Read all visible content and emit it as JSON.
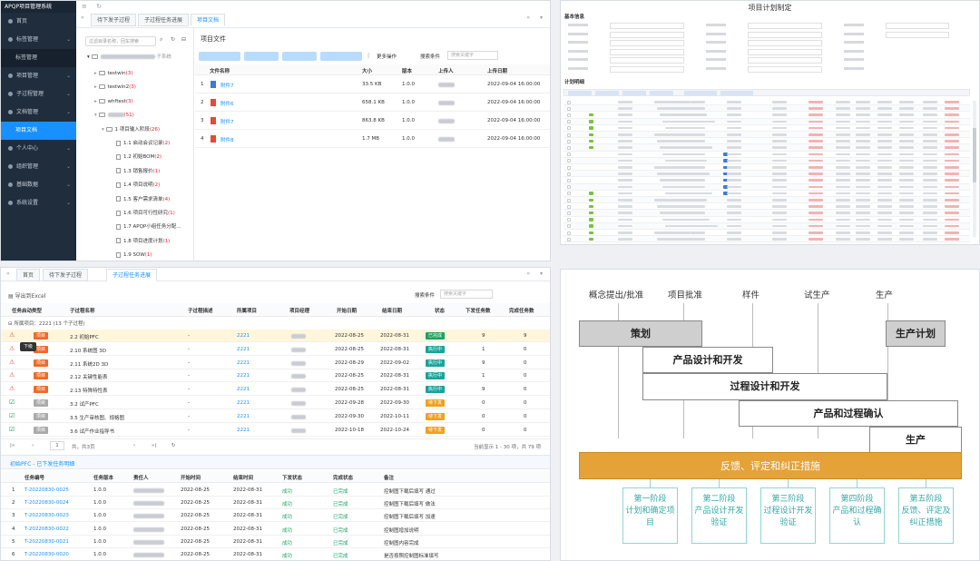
{
  "panel1": {
    "app_title": "APQP项目管理系统",
    "sidebar": [
      {
        "label": "首页",
        "expandable": false
      },
      {
        "label": "标签管理",
        "expandable": true
      },
      {
        "label": "标签管理",
        "sub": true
      },
      {
        "label": "项目管理",
        "expandable": true
      },
      {
        "label": "子过程管理",
        "expandable": true
      },
      {
        "label": "文档管理",
        "expandable": true
      },
      {
        "label": "项目文档",
        "sub": true,
        "active": true
      },
      {
        "label": "个人中心",
        "expandable": true
      },
      {
        "label": "组织管理",
        "expandable": true
      },
      {
        "label": "基础数据",
        "expandable": true
      },
      {
        "label": "系统设置",
        "expandable": true
      }
    ],
    "tabs": [
      "待下发子过程",
      "子过程任务进展",
      "项目文档"
    ],
    "tree_search_placeholder": "过滤目录名称，回车搜索",
    "pane_title": "项目文件",
    "tree": [
      {
        "label": "testwin",
        "count": "(3)",
        "level": 1
      },
      {
        "label": "testwin2",
        "count": "(3)",
        "level": 1
      },
      {
        "label": "whftest",
        "count": "(3)",
        "level": 1
      },
      {
        "label": "",
        "count": "(51)",
        "level": 1,
        "blur": true
      },
      {
        "label": "1 项目输入阶段",
        "count": "(26)",
        "level": 2
      },
      {
        "label": "1.1 启动会议记录",
        "count": "(2)",
        "level": 3
      },
      {
        "label": "1.2 初始BOM",
        "count": "(2)",
        "level": 3
      },
      {
        "label": "1.3 销售报价",
        "count": "(1)",
        "level": 3
      },
      {
        "label": "1.4 项目说明",
        "count": "(2)",
        "level": 3
      },
      {
        "label": "1.5 客户需求清单",
        "count": "(4)",
        "level": 3
      },
      {
        "label": "1.6 项目可行性研究",
        "count": "(1)",
        "level": 3
      },
      {
        "label": "1.7 APQP小组任务分配...",
        "count": "",
        "level": 3
      },
      {
        "label": "1.8 项目进度计划",
        "count": "(1)",
        "level": 3
      },
      {
        "label": "1.9 SOW",
        "count": "(1)",
        "level": 3
      },
      {
        "label": "1.10 数据2D",
        "count": "(1)",
        "level": 3
      }
    ],
    "toolbar": {
      "more": "更多操作",
      "search_label": "搜索条件",
      "search_placeholder": "搜索关键字"
    },
    "file_columns": [
      "文件名称",
      "大小",
      "版本",
      "上传人",
      "上传日期"
    ],
    "files": [
      {
        "no": "1",
        "name": "附件7",
        "size": "33.5 KB",
        "version": "1.0.0",
        "date": "2022-09-04 16:00:00",
        "icon": "blue"
      },
      {
        "no": "2",
        "name": "附件6",
        "size": "658.1 KB",
        "version": "1.0.0",
        "date": "2022-09-04 16:00:00",
        "icon": "red"
      },
      {
        "no": "3",
        "name": "附件7",
        "size": "863.8 KB",
        "version": "1.0.0",
        "date": "2022-09-04 16:00:00",
        "icon": "red"
      },
      {
        "no": "4",
        "name": "附件8",
        "size": "1.7 MB",
        "version": "1.0.0",
        "date": "2022-09-04 16:00:00",
        "icon": "red"
      }
    ]
  },
  "panel2": {
    "title": "项目计划制定",
    "section_basic": "基本信息",
    "section_plan": "计划明细"
  },
  "panel3": {
    "tabs": [
      "首页",
      "待下发子过程",
      "子过程任务进展"
    ],
    "export_label": "导出到Excel",
    "search_label": "搜索条件",
    "search_placeholder": "搜索关键字",
    "columns": [
      "任务启动类型",
      "子过程名称",
      "子过程描述",
      "所属项目",
      "项目经理",
      "开始日期",
      "结束日期",
      "状态",
      "下发任务数",
      "完成任务数"
    ],
    "group_label": "所属项目：2221 (13 个子过程)",
    "rows": [
      {
        "type": "项目",
        "name": "2.2 初始PFC",
        "desc": "-",
        "project": "2221",
        "start": "2022-08-25",
        "end": "2022-08-31",
        "status": "已完成",
        "sc": "#1aa260",
        "issued": "9",
        "done": "9",
        "icon": "warn",
        "hl": true
      },
      {
        "type": "项目",
        "name": "2.10 系统图 3D",
        "desc": "-",
        "project": "2221",
        "start": "2022-08-25",
        "end": "2022-08-31",
        "status": "执行中",
        "sc": "#1aa39a",
        "issued": "1",
        "done": "0",
        "icon": "warn"
      },
      {
        "type": "项目",
        "name": "2.11 系统2D 3D",
        "desc": "-",
        "project": "2221",
        "start": "2022-08-29",
        "end": "2022-09-02",
        "status": "执行中",
        "sc": "#1aa39a",
        "issued": "9",
        "done": "0",
        "icon": "warn"
      },
      {
        "type": "项目",
        "name": "2.12 关键性能表",
        "desc": "-",
        "project": "2221",
        "start": "2022-08-25",
        "end": "2022-08-31",
        "status": "执行中",
        "sc": "#1aa39a",
        "issued": "1",
        "done": "0",
        "icon": "warn"
      },
      {
        "type": "项目",
        "name": "2.13 特殊特性表",
        "desc": "-",
        "project": "2221",
        "start": "2022-08-25",
        "end": "2022-08-31",
        "status": "执行中",
        "sc": "#1aa39a",
        "issued": "9",
        "done": "0",
        "icon": "warn"
      },
      {
        "type": "项目",
        "name": "3.2 试产PFC",
        "desc": "-",
        "project": "2221",
        "start": "2022-09-28",
        "end": "2022-09-30",
        "status": "待下发",
        "sc": "#f0a020",
        "issued": "0",
        "done": "0",
        "icon": "ok"
      },
      {
        "type": "项目",
        "name": "3.5 生产审核图、规格图",
        "desc": "-",
        "project": "2221",
        "start": "2022-09-30",
        "end": "2022-10-11",
        "status": "待下发",
        "sc": "#f0a020",
        "issued": "0",
        "done": "0",
        "icon": "ok"
      },
      {
        "type": "项目",
        "name": "3.6 试产作业指导书",
        "desc": "-",
        "project": "2221",
        "start": "2022-10-18",
        "end": "2022-10-24",
        "status": "待下发",
        "sc": "#f0a020",
        "issued": "0",
        "done": "0",
        "icon": "ok"
      }
    ],
    "pager": "当前显示 1 - 30 项，共 79 项",
    "pager_page": "1",
    "pager_total": "共，共3页",
    "detail_title": "初始PFC - 已下发任务明细",
    "detail_columns": [
      "任务编号",
      "任务版本",
      "责任人",
      "开始时间",
      "结束时间",
      "下发状态",
      "完成状态",
      "备注"
    ],
    "detail_rows": [
      {
        "no": "1",
        "id": "T-20220830-0025",
        "ver": "1.0.0",
        "start": "2022-08-25",
        "end": "2022-08-31",
        "issue": "成功",
        "done": "已完成",
        "note": "控制图下载后填写 通过"
      },
      {
        "no": "2",
        "id": "T-20220830-0024",
        "ver": "1.0.0",
        "start": "2022-08-25",
        "end": "2022-08-31",
        "issue": "成功",
        "done": "已完成",
        "note": "控制图下载后填写 做法"
      },
      {
        "no": "3",
        "id": "T-20220830-0023",
        "ver": "1.0.0",
        "start": "2022-08-25",
        "end": "2022-08-31",
        "issue": "成功",
        "done": "已完成",
        "note": "控制图下载后填写 加速"
      },
      {
        "no": "4",
        "id": "T-20220830-0022",
        "ver": "1.0.0",
        "start": "2022-08-25",
        "end": "2022-08-31",
        "issue": "成功",
        "done": "已完成",
        "note": "控制图增加说明"
      },
      {
        "no": "5",
        "id": "T-20220830-0021",
        "ver": "1.0.0",
        "start": "2022-08-25",
        "end": "2022-08-31",
        "issue": "成功",
        "done": "已完成",
        "note": "控制图内容完成"
      },
      {
        "no": "6",
        "id": "T-20220830-0020",
        "ver": "1.0.0",
        "start": "2022-08-25",
        "end": "2022-08-31",
        "issue": "成功",
        "done": "已完成",
        "note": "是否按照控制图标准填写"
      }
    ]
  },
  "panel4": {
    "milestones": [
      "概念提出/批准",
      "项目批准",
      "样件",
      "试生产",
      "生产"
    ],
    "bars": [
      "策划",
      "产品设计和开发",
      "过程设计和开发",
      "产品和过程确认",
      "生产",
      "生产计划"
    ],
    "feedback": "反馈、评定和纠正措施",
    "phases": [
      [
        "第一阶段",
        "计划和确定项",
        "目"
      ],
      [
        "第二阶段",
        "产品设计开发",
        "验证"
      ],
      [
        "第三阶段",
        "过程设计开发",
        "验证"
      ],
      [
        "第四阶段",
        "产品和过程确",
        "认"
      ],
      [
        "第五阶段",
        "反馈、评定及",
        "纠正措施"
      ]
    ]
  }
}
